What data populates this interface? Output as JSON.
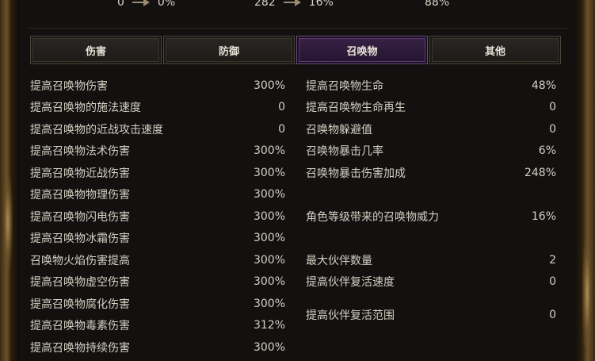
{
  "summary": [
    {
      "from": "0",
      "to": "0%"
    },
    {
      "from": "282",
      "to": "16%"
    },
    {
      "to": "88%"
    }
  ],
  "tabs": [
    {
      "label": "伤害",
      "active": false
    },
    {
      "label": "防御",
      "active": false
    },
    {
      "label": "召唤物",
      "active": true
    },
    {
      "label": "其他",
      "active": false
    }
  ],
  "left_stats": [
    {
      "label": "提高召唤物伤害",
      "value": "300%"
    },
    {
      "label": "提高召唤物的施法速度",
      "value": "0"
    },
    {
      "label": "提高召唤物的近战攻击速度",
      "value": "0"
    },
    {
      "label": "提高召唤物法术伤害",
      "value": "300%"
    },
    {
      "label": "提高召唤物近战伤害",
      "value": "300%"
    },
    {
      "label": "提高召唤物物理伤害",
      "value": "300%"
    },
    {
      "label": "提高召唤物闪电伤害",
      "value": "300%"
    },
    {
      "label": "提高召唤物冰霜伤害",
      "value": "300%"
    },
    {
      "label": "召唤物火焰伤害提高",
      "value": "300%"
    },
    {
      "label": "提高召唤物虚空伤害",
      "value": "300%"
    },
    {
      "label": "提高召唤物腐化伤害",
      "value": "300%"
    },
    {
      "label": "提高召唤物毒素伤害",
      "value": "312%"
    },
    {
      "label": "提高召唤物持续伤害",
      "value": "300%"
    }
  ],
  "right_stats": [
    {
      "label": "提高召唤物生命",
      "value": "48%"
    },
    {
      "label": "提高召唤物生命再生",
      "value": "0"
    },
    {
      "label": "召唤物躲避值",
      "value": "0"
    },
    {
      "label": "召唤物暴击几率",
      "value": "6%"
    },
    {
      "label": "召唤物暴击伤害加成",
      "value": "248%"
    },
    {
      "label": "角色等级带来的召唤物威力",
      "value": "16%"
    },
    {
      "label": "最大伙伴数量",
      "value": "2"
    },
    {
      "label": "提高伙伴复活速度",
      "value": "0"
    },
    {
      "label": "提高伙伴复活范围",
      "value": "0"
    }
  ]
}
